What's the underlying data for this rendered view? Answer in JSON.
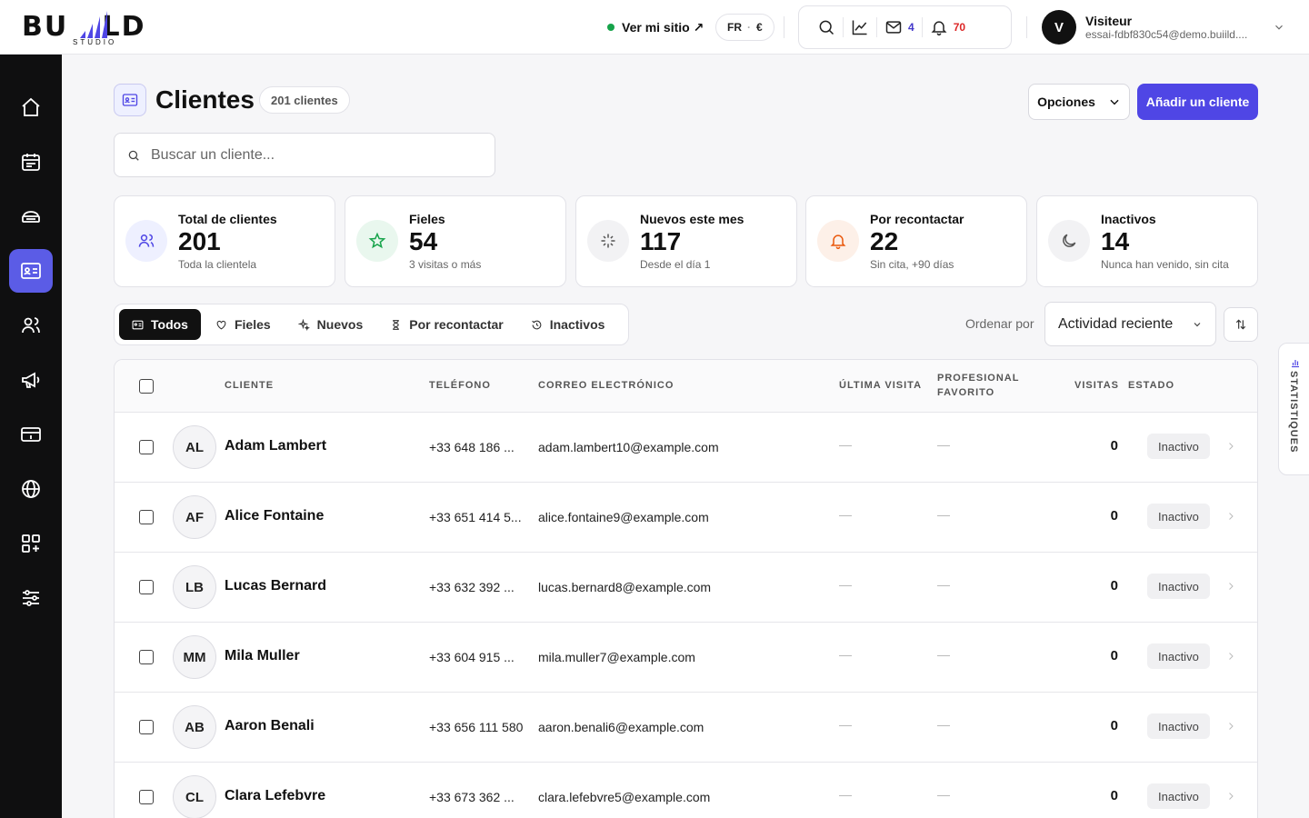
{
  "brand": {
    "logo_text": "BUILD",
    "logo_sub": "STUDIO"
  },
  "topbar": {
    "site_link": "Ver mi sitio ↗",
    "lang": "FR",
    "currency": "€",
    "mail_count": "4",
    "notif_count": "70",
    "user_initial": "V",
    "user_name": "Visiteur",
    "user_email": "essai-fdbf830c54@demo.buiild...."
  },
  "page": {
    "title": "Clientes",
    "count_label": "201 clientes",
    "options_label": "Opciones",
    "add_label": "Añadir un cliente",
    "search_placeholder": "Buscar un cliente..."
  },
  "stats": [
    {
      "label": "Total de clientes",
      "value": "201",
      "sub": "Toda la clientela",
      "icon": "users-icon",
      "color": "#4f46e5",
      "bg": "#eef0ff"
    },
    {
      "label": "Fieles",
      "value": "54",
      "sub": "3 visitas o más",
      "icon": "star-icon",
      "color": "#16a34a",
      "bg": "#e9f7ee"
    },
    {
      "label": "Nuevos este mes",
      "value": "117",
      "sub": "Desde el día 1",
      "icon": "sparkle-icon",
      "color": "#555555",
      "bg": "#f2f2f4"
    },
    {
      "label": "Por recontactar",
      "value": "22",
      "sub": "Sin cita, +90 días",
      "icon": "bell-icon",
      "color": "#ea580c",
      "bg": "#fdf0e8"
    },
    {
      "label": "Inactivos",
      "value": "14",
      "sub": "Nunca han venido, sin cita",
      "icon": "moon-icon",
      "color": "#555555",
      "bg": "#f2f2f4"
    }
  ],
  "filters": [
    {
      "label": "Todos",
      "icon": "id-card-icon",
      "active": true
    },
    {
      "label": "Fieles",
      "icon": "heart-icon",
      "active": false
    },
    {
      "label": "Nuevos",
      "icon": "sparkle-icon",
      "active": false
    },
    {
      "label": "Por recontactar",
      "icon": "hourglass-icon",
      "active": false
    },
    {
      "label": "Inactivos",
      "icon": "history-icon",
      "active": false
    }
  ],
  "sort": {
    "label": "Ordenar por",
    "value": "Actividad reciente"
  },
  "table": {
    "headers": {
      "client": "CLIENTE",
      "phone": "TELÉFONO",
      "email": "CORREO ELECTRÓNICO",
      "last_visit": "ÚLTIMA VISITA",
      "fav_pro_1": "PROFESIONAL",
      "fav_pro_2": "FAVORITO",
      "visits": "VISITAS",
      "status": "ESTADO"
    },
    "rows": [
      {
        "initials": "AL",
        "name": "Adam Lambert",
        "phone": "+33 648 186 ...",
        "email": "adam.lambert10@example.com",
        "visits": "0",
        "status": "Inactivo"
      },
      {
        "initials": "AF",
        "name": "Alice Fontaine",
        "phone": "+33 651 414 5...",
        "email": "alice.fontaine9@example.com",
        "visits": "0",
        "status": "Inactivo"
      },
      {
        "initials": "LB",
        "name": "Lucas Bernard",
        "phone": "+33 632 392 ...",
        "email": "lucas.bernard8@example.com",
        "visits": "0",
        "status": "Inactivo"
      },
      {
        "initials": "MM",
        "name": "Mila Muller",
        "phone": "+33 604 915 ...",
        "email": "mila.muller7@example.com",
        "visits": "0",
        "status": "Inactivo"
      },
      {
        "initials": "AB",
        "name": "Aaron Benali",
        "phone": "+33 656 111 580",
        "email": "aaron.benali6@example.com",
        "visits": "0",
        "status": "Inactivo"
      },
      {
        "initials": "CL",
        "name": "Clara Lefebvre",
        "phone": "+33 673 362 ...",
        "email": "clara.lefebvre5@example.com",
        "visits": "0",
        "status": "Inactivo"
      }
    ]
  },
  "side_panel": {
    "label": "STATISTIQUES"
  },
  "sidebar": [
    {
      "icon": "home-icon",
      "active": false
    },
    {
      "icon": "calendar-icon",
      "active": false
    },
    {
      "icon": "services-icon",
      "active": false
    },
    {
      "icon": "clients-icon",
      "active": true
    },
    {
      "icon": "team-icon",
      "active": false
    },
    {
      "icon": "megaphone-icon",
      "active": false
    },
    {
      "icon": "payments-icon",
      "active": false
    },
    {
      "icon": "globe-icon",
      "active": false
    },
    {
      "icon": "apps-icon",
      "active": false
    },
    {
      "icon": "settings-sliders-icon",
      "active": false
    }
  ]
}
